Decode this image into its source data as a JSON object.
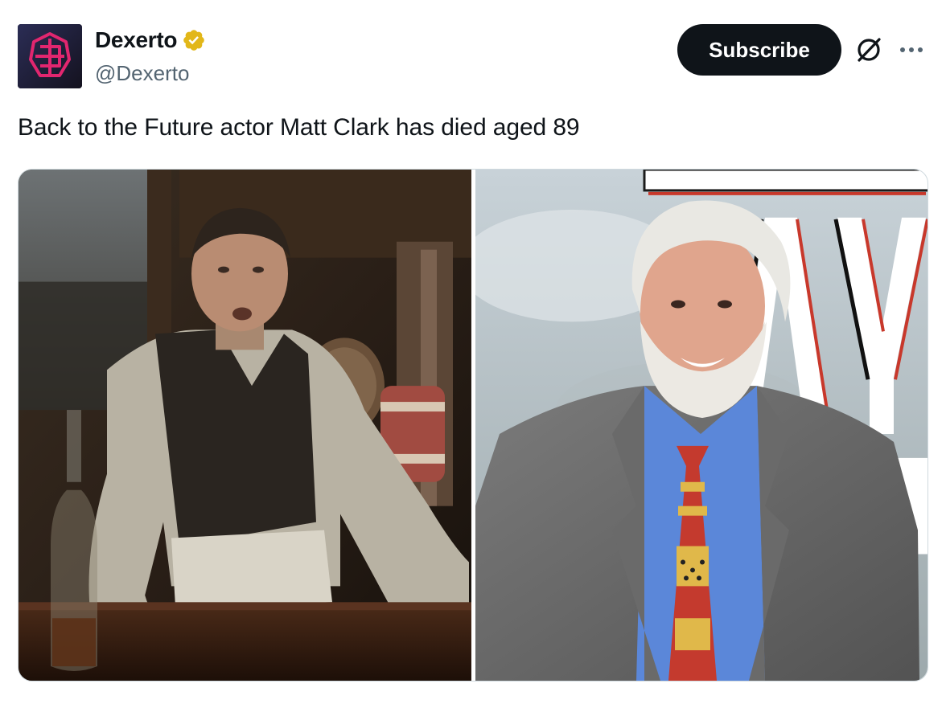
{
  "author": {
    "display_name": "Dexerto",
    "handle": "@Dexerto",
    "avatar_icon": "dexerto-logo-icon",
    "verified_badge": "verified-gold-badge-icon",
    "brand_color": "#e2266f"
  },
  "actions": {
    "subscribe_label": "Subscribe",
    "grok_icon": "grok-icon",
    "more_icon": "more-options-icon"
  },
  "tweet": {
    "text": "Back to the Future actor Matt Clark has died aged 89"
  },
  "media": {
    "left_photo": "actor-in-western-saloon-photo",
    "right_photo": "actor-at-premiere-photo"
  }
}
